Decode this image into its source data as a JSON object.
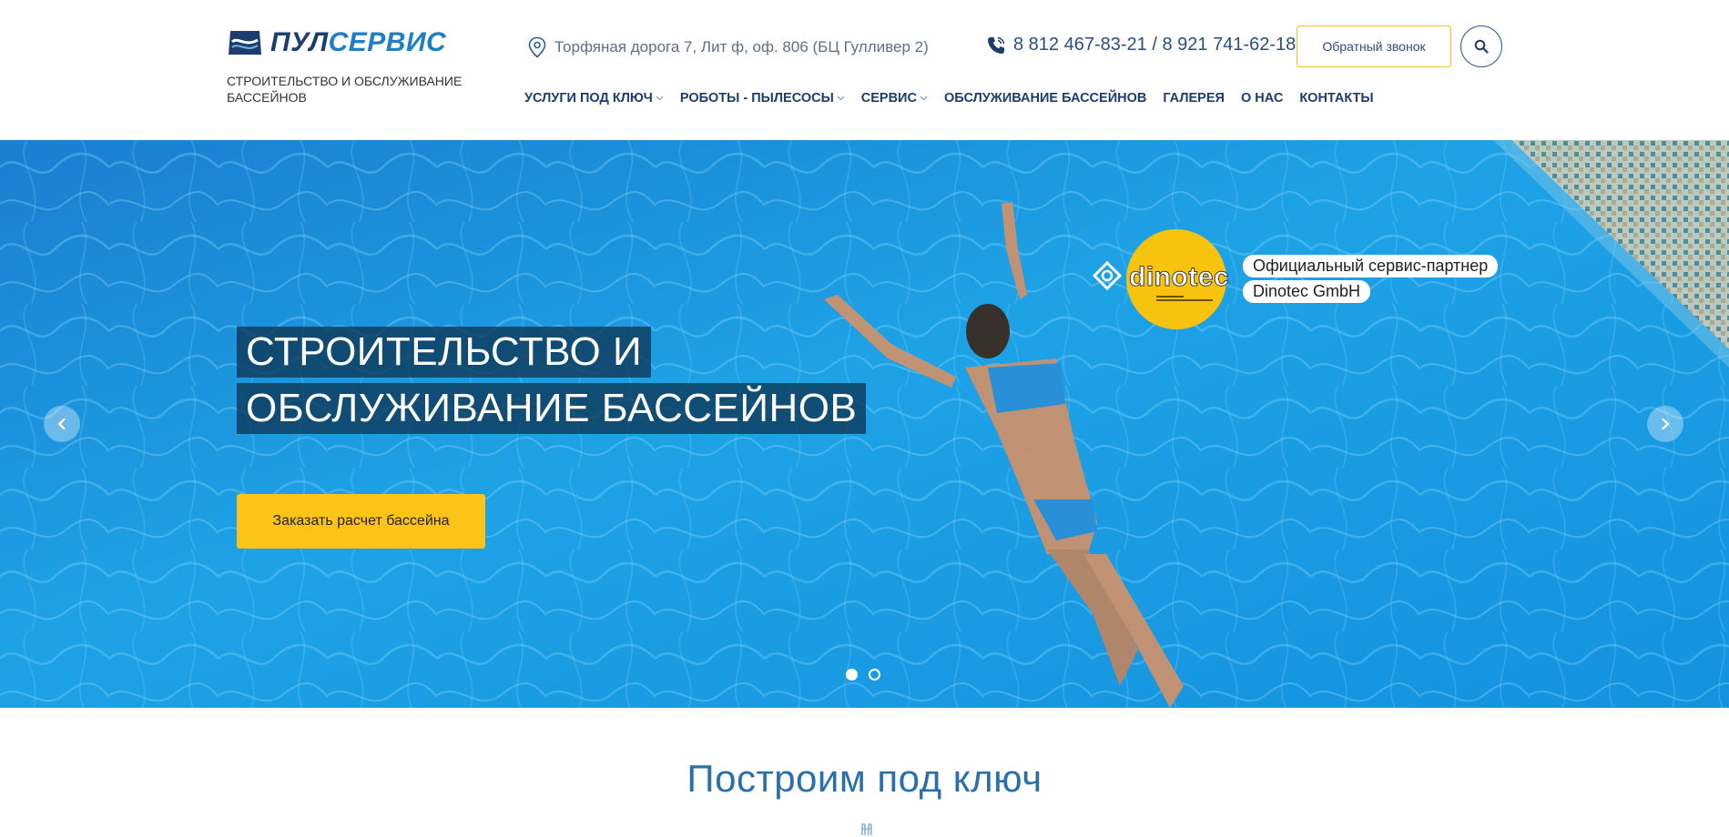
{
  "header": {
    "logo": {
      "part1": "ПУЛ",
      "part2": "СЕРВИС"
    },
    "tagline": "СТРОИТЕЛЬСТВО И ОБСЛУЖИВАНИЕ БАССЕЙНОВ",
    "address": "Торфяная дорога 7, Лит ф, оф. 806 (БЦ Гулливер 2)",
    "phones": "8 812 467-83-21 / 8 921 741-62-18",
    "callback_label": "Обратный звонок",
    "nav": [
      {
        "label": "УСЛУГИ ПОД КЛЮЧ",
        "dropdown": true
      },
      {
        "label": "РОБОТЫ - ПЫЛЕСОСЫ",
        "dropdown": true
      },
      {
        "label": "СЕРВИС",
        "dropdown": true
      },
      {
        "label": "ОБСЛУЖИВАНИЕ БАССЕЙНОВ",
        "dropdown": false
      },
      {
        "label": "ГАЛЕРЕЯ",
        "dropdown": false
      },
      {
        "label": "О НАС",
        "dropdown": false
      },
      {
        "label": "КОНТАКТЫ",
        "dropdown": false
      }
    ]
  },
  "hero": {
    "title_line1": "СТРОИТЕЛЬСТВО И",
    "title_line2": "ОБСЛУЖИВАНИЕ БАССЕЙНОВ",
    "cta_label": "Заказать расчет бассейна",
    "partner": {
      "brand": "dinotec",
      "badge_line1": "Официальный сервис-партнер",
      "badge_line2": "Dinotec GmbH"
    },
    "slides": {
      "count": 2,
      "active": 1
    }
  },
  "section": {
    "title": "Построим под ключ"
  },
  "colors": {
    "brand_dark": "#1c3d6e",
    "brand_light": "#1f7fc4",
    "accent_yellow": "#fcc417",
    "water": "#1e9be0"
  },
  "icons": {
    "address": "map-pin-icon",
    "phone": "phone-icon",
    "search": "search-icon",
    "prev": "chevron-left-icon",
    "next": "chevron-right-icon"
  }
}
